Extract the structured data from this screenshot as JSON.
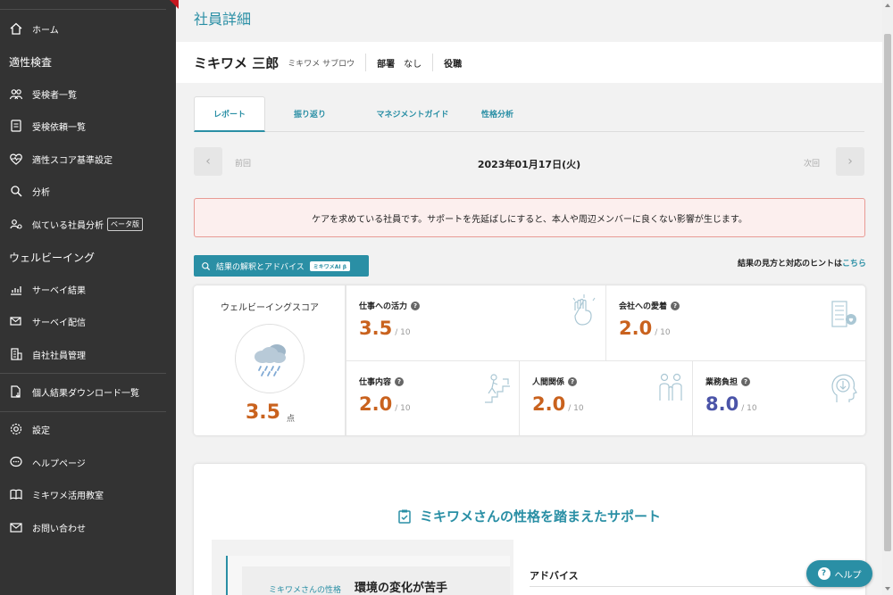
{
  "sidebar": {
    "home": "ホーム",
    "section_aptitude": "適性検査",
    "examinees": "受検者一覧",
    "requests": "受検依頼一覧",
    "score_settings": "適性スコア基準設定",
    "analysis": "分析",
    "similar_employees": "似ている社員分析",
    "beta_badge": "ベータ版",
    "section_wellbeing": "ウェルビーイング",
    "survey_results": "サーベイ結果",
    "survey_delivery": "サーベイ配信",
    "employee_management": "自社社員管理",
    "download_list": "個人結果ダウンロード一覧",
    "settings": "設定",
    "help_page": "ヘルプページ",
    "classroom": "ミキワメ活用教室",
    "contact": "お問い合わせ"
  },
  "page": {
    "title": "社員詳細"
  },
  "employee": {
    "name": "ミキワメ 三郎",
    "kana": "ミキワメ サブロウ",
    "dept_label": "部署",
    "dept_value": "なし",
    "role_label": "役職"
  },
  "tabs": [
    "レポート",
    "振り返り",
    "マネジメントガイド",
    "性格分析"
  ],
  "date_nav": {
    "prev": "前回",
    "next": "次回",
    "date": "2023年01月17日(火)"
  },
  "alert": "ケアを求めている社員です。サポートを先延ばしにすると、本人や周辺メンバーに良くない影響が生じます。",
  "advice_button": {
    "label": "結果の解釈とアドバイス",
    "badge": "ミキワメAI β"
  },
  "hint": {
    "text": "結果の見方と対応のヒントは",
    "link": "こちら"
  },
  "wellbeing": {
    "title": "ウェルビーイングスコア",
    "score": "3.5",
    "unit": "点",
    "weather_icon": "rain-cloud-icon",
    "score_color": "#c9621e"
  },
  "metrics": [
    {
      "label": "仕事への活力",
      "value": "3.5",
      "denom": "/ 10",
      "color": "#c9621e",
      "icon": "fist-icon"
    },
    {
      "label": "会社への愛着",
      "value": "2.0",
      "denom": "/ 10",
      "color": "#c9621e",
      "icon": "building-heart-icon"
    },
    {
      "label": "仕事内容",
      "value": "2.0",
      "denom": "/ 10",
      "color": "#c9621e",
      "icon": "climbing-stairs-icon"
    },
    {
      "label": "人間関係",
      "value": "2.0",
      "denom": "/ 10",
      "color": "#c9621e",
      "icon": "two-people-icon"
    },
    {
      "label": "業務負担",
      "value": "8.0",
      "denom": "/ 10",
      "color": "#4b54a8",
      "icon": "head-down-arrow-icon"
    }
  ],
  "support": {
    "title": "ミキワメさんの性格を踏まえたサポート",
    "personality_label": "ミキワメさんの性格",
    "personality_value": "環境の変化が苦手",
    "advice_label": "アドバイス"
  },
  "help_button": "ヘルプ",
  "colors": {
    "accent": "#2a8fa5",
    "sidebar_bg": "#333333",
    "alert_bg": "#fcefee",
    "alert_border": "#e89b95",
    "low_score": "#c9621e",
    "high_load": "#4b54a8"
  }
}
